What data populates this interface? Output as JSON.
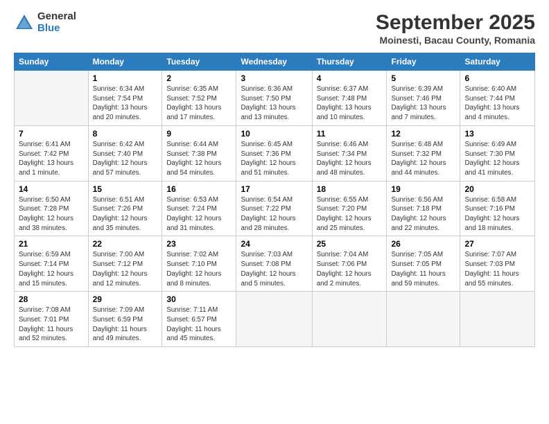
{
  "logo": {
    "general": "General",
    "blue": "Blue"
  },
  "title": "September 2025",
  "subtitle": "Moinesti, Bacau County, Romania",
  "headers": [
    "Sunday",
    "Monday",
    "Tuesday",
    "Wednesday",
    "Thursday",
    "Friday",
    "Saturday"
  ],
  "rows": [
    [
      {
        "day": "",
        "empty": true
      },
      {
        "day": "1",
        "sunrise": "Sunrise: 6:34 AM",
        "sunset": "Sunset: 7:54 PM",
        "daylight": "Daylight: 13 hours and 20 minutes."
      },
      {
        "day": "2",
        "sunrise": "Sunrise: 6:35 AM",
        "sunset": "Sunset: 7:52 PM",
        "daylight": "Daylight: 13 hours and 17 minutes."
      },
      {
        "day": "3",
        "sunrise": "Sunrise: 6:36 AM",
        "sunset": "Sunset: 7:50 PM",
        "daylight": "Daylight: 13 hours and 13 minutes."
      },
      {
        "day": "4",
        "sunrise": "Sunrise: 6:37 AM",
        "sunset": "Sunset: 7:48 PM",
        "daylight": "Daylight: 13 hours and 10 minutes."
      },
      {
        "day": "5",
        "sunrise": "Sunrise: 6:39 AM",
        "sunset": "Sunset: 7:46 PM",
        "daylight": "Daylight: 13 hours and 7 minutes."
      },
      {
        "day": "6",
        "sunrise": "Sunrise: 6:40 AM",
        "sunset": "Sunset: 7:44 PM",
        "daylight": "Daylight: 13 hours and 4 minutes."
      }
    ],
    [
      {
        "day": "7",
        "sunrise": "Sunrise: 6:41 AM",
        "sunset": "Sunset: 7:42 PM",
        "daylight": "Daylight: 13 hours and 1 minute."
      },
      {
        "day": "8",
        "sunrise": "Sunrise: 6:42 AM",
        "sunset": "Sunset: 7:40 PM",
        "daylight": "Daylight: 12 hours and 57 minutes."
      },
      {
        "day": "9",
        "sunrise": "Sunrise: 6:44 AM",
        "sunset": "Sunset: 7:38 PM",
        "daylight": "Daylight: 12 hours and 54 minutes."
      },
      {
        "day": "10",
        "sunrise": "Sunrise: 6:45 AM",
        "sunset": "Sunset: 7:36 PM",
        "daylight": "Daylight: 12 hours and 51 minutes."
      },
      {
        "day": "11",
        "sunrise": "Sunrise: 6:46 AM",
        "sunset": "Sunset: 7:34 PM",
        "daylight": "Daylight: 12 hours and 48 minutes."
      },
      {
        "day": "12",
        "sunrise": "Sunrise: 6:48 AM",
        "sunset": "Sunset: 7:32 PM",
        "daylight": "Daylight: 12 hours and 44 minutes."
      },
      {
        "day": "13",
        "sunrise": "Sunrise: 6:49 AM",
        "sunset": "Sunset: 7:30 PM",
        "daylight": "Daylight: 12 hours and 41 minutes."
      }
    ],
    [
      {
        "day": "14",
        "sunrise": "Sunrise: 6:50 AM",
        "sunset": "Sunset: 7:28 PM",
        "daylight": "Daylight: 12 hours and 38 minutes."
      },
      {
        "day": "15",
        "sunrise": "Sunrise: 6:51 AM",
        "sunset": "Sunset: 7:26 PM",
        "daylight": "Daylight: 12 hours and 35 minutes."
      },
      {
        "day": "16",
        "sunrise": "Sunrise: 6:53 AM",
        "sunset": "Sunset: 7:24 PM",
        "daylight": "Daylight: 12 hours and 31 minutes."
      },
      {
        "day": "17",
        "sunrise": "Sunrise: 6:54 AM",
        "sunset": "Sunset: 7:22 PM",
        "daylight": "Daylight: 12 hours and 28 minutes."
      },
      {
        "day": "18",
        "sunrise": "Sunrise: 6:55 AM",
        "sunset": "Sunset: 7:20 PM",
        "daylight": "Daylight: 12 hours and 25 minutes."
      },
      {
        "day": "19",
        "sunrise": "Sunrise: 6:56 AM",
        "sunset": "Sunset: 7:18 PM",
        "daylight": "Daylight: 12 hours and 22 minutes."
      },
      {
        "day": "20",
        "sunrise": "Sunrise: 6:58 AM",
        "sunset": "Sunset: 7:16 PM",
        "daylight": "Daylight: 12 hours and 18 minutes."
      }
    ],
    [
      {
        "day": "21",
        "sunrise": "Sunrise: 6:59 AM",
        "sunset": "Sunset: 7:14 PM",
        "daylight": "Daylight: 12 hours and 15 minutes."
      },
      {
        "day": "22",
        "sunrise": "Sunrise: 7:00 AM",
        "sunset": "Sunset: 7:12 PM",
        "daylight": "Daylight: 12 hours and 12 minutes."
      },
      {
        "day": "23",
        "sunrise": "Sunrise: 7:02 AM",
        "sunset": "Sunset: 7:10 PM",
        "daylight": "Daylight: 12 hours and 8 minutes."
      },
      {
        "day": "24",
        "sunrise": "Sunrise: 7:03 AM",
        "sunset": "Sunset: 7:08 PM",
        "daylight": "Daylight: 12 hours and 5 minutes."
      },
      {
        "day": "25",
        "sunrise": "Sunrise: 7:04 AM",
        "sunset": "Sunset: 7:06 PM",
        "daylight": "Daylight: 12 hours and 2 minutes."
      },
      {
        "day": "26",
        "sunrise": "Sunrise: 7:05 AM",
        "sunset": "Sunset: 7:05 PM",
        "daylight": "Daylight: 11 hours and 59 minutes."
      },
      {
        "day": "27",
        "sunrise": "Sunrise: 7:07 AM",
        "sunset": "Sunset: 7:03 PM",
        "daylight": "Daylight: 11 hours and 55 minutes."
      }
    ],
    [
      {
        "day": "28",
        "sunrise": "Sunrise: 7:08 AM",
        "sunset": "Sunset: 7:01 PM",
        "daylight": "Daylight: 11 hours and 52 minutes."
      },
      {
        "day": "29",
        "sunrise": "Sunrise: 7:09 AM",
        "sunset": "Sunset: 6:59 PM",
        "daylight": "Daylight: 11 hours and 49 minutes."
      },
      {
        "day": "30",
        "sunrise": "Sunrise: 7:11 AM",
        "sunset": "Sunset: 6:57 PM",
        "daylight": "Daylight: 11 hours and 45 minutes."
      },
      {
        "day": "",
        "empty": true
      },
      {
        "day": "",
        "empty": true
      },
      {
        "day": "",
        "empty": true
      },
      {
        "day": "",
        "empty": true
      }
    ]
  ]
}
